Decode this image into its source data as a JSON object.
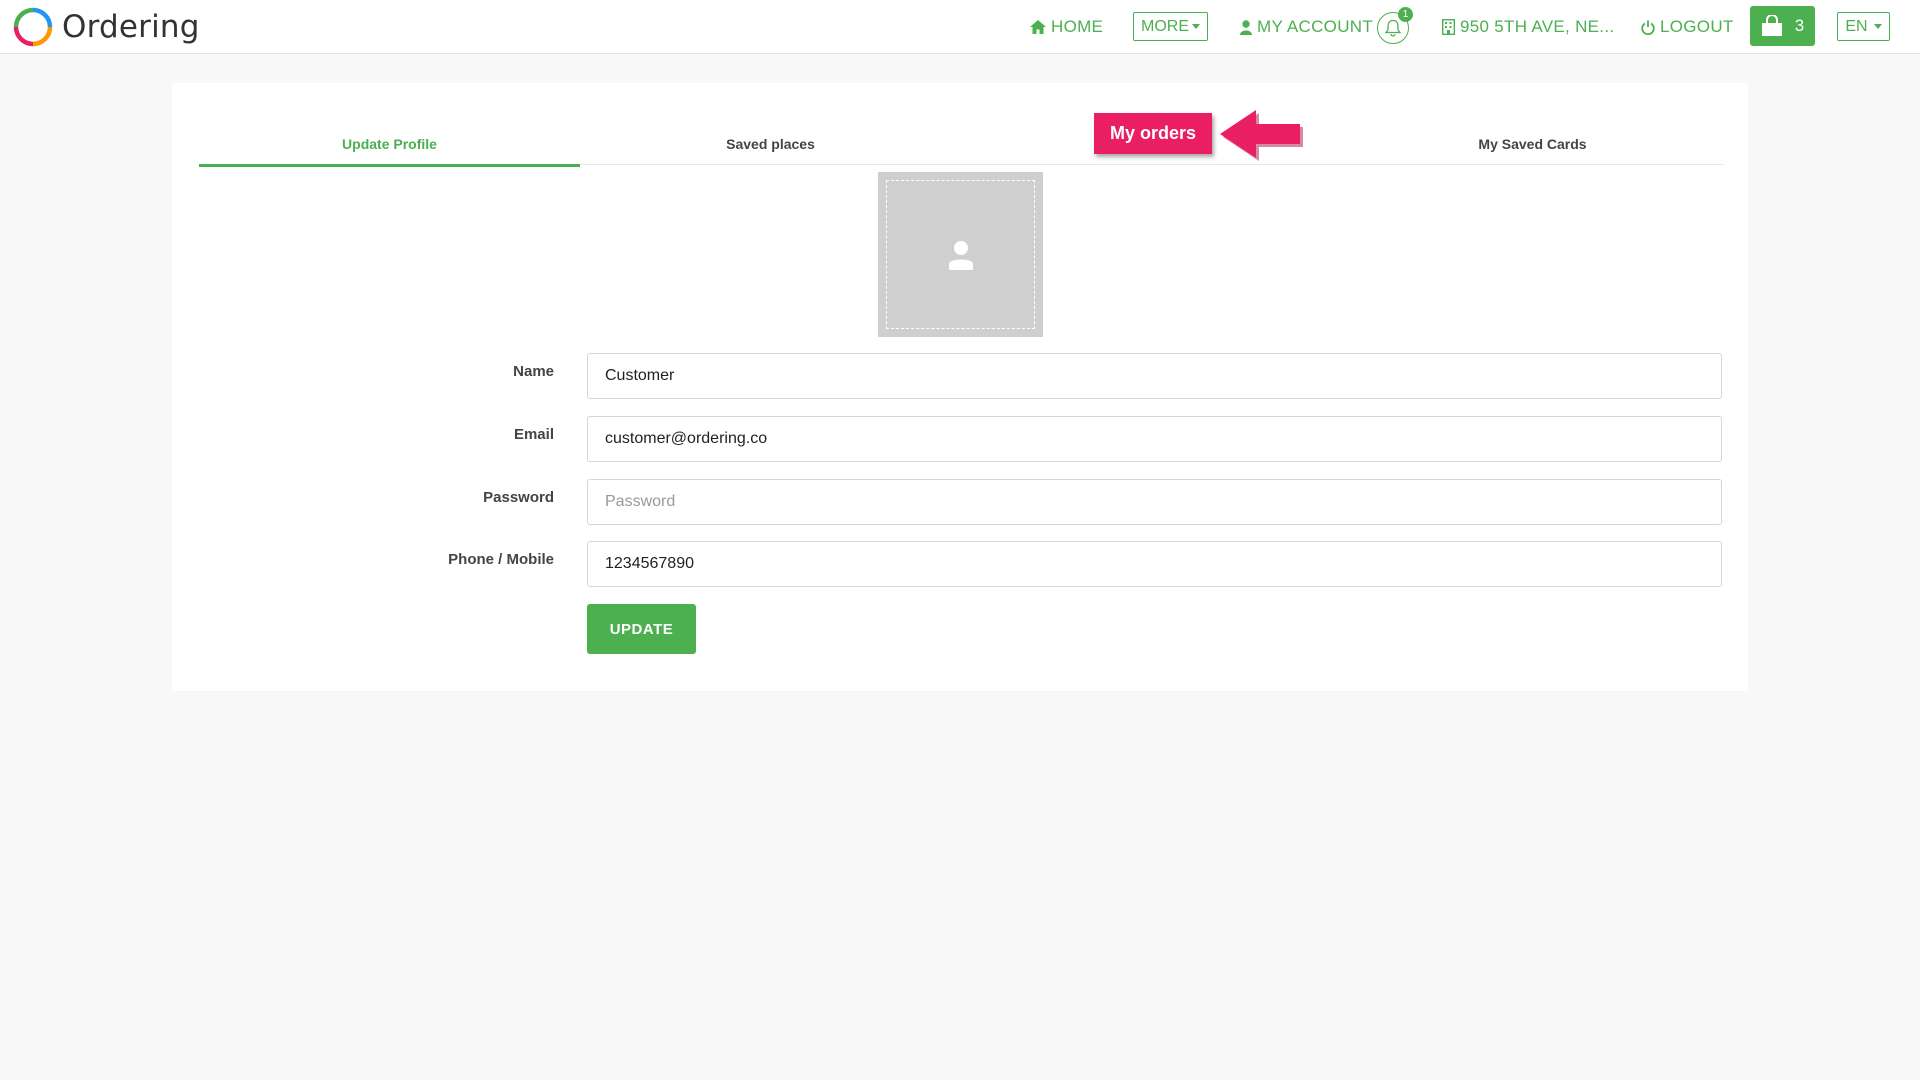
{
  "brand": {
    "name": "Ordering"
  },
  "nav": {
    "home": "HOME",
    "more": "MORE",
    "my_account": "MY ACCOUNT",
    "notification_count": "1",
    "address": "950 5TH AVE, NE...",
    "logout": "LOGOUT",
    "cart_count": "3",
    "language": "EN"
  },
  "tabs": [
    {
      "label": "Update Profile",
      "active": true
    },
    {
      "label": "Saved places",
      "active": false
    },
    {
      "label": "",
      "active": false
    },
    {
      "label": "My Saved Cards",
      "active": false
    }
  ],
  "form": {
    "name_label": "Name",
    "name_value": "Customer",
    "email_label": "Email",
    "email_value": "customer@ordering.co",
    "password_label": "Password",
    "password_placeholder": "Password",
    "phone_label": "Phone / Mobile",
    "phone_value": "1234567890",
    "update_button": "UPDATE"
  },
  "annotation": {
    "label": "My orders"
  },
  "colors": {
    "accent": "#4caf50",
    "annotation": "#e91e63",
    "background": "#f8f8f8"
  },
  "icons": [
    "home-icon",
    "user-icon",
    "bell-icon",
    "building-icon",
    "power-icon",
    "shopping-bag-icon",
    "avatar-placeholder-icon",
    "arrow-left-icon"
  ]
}
